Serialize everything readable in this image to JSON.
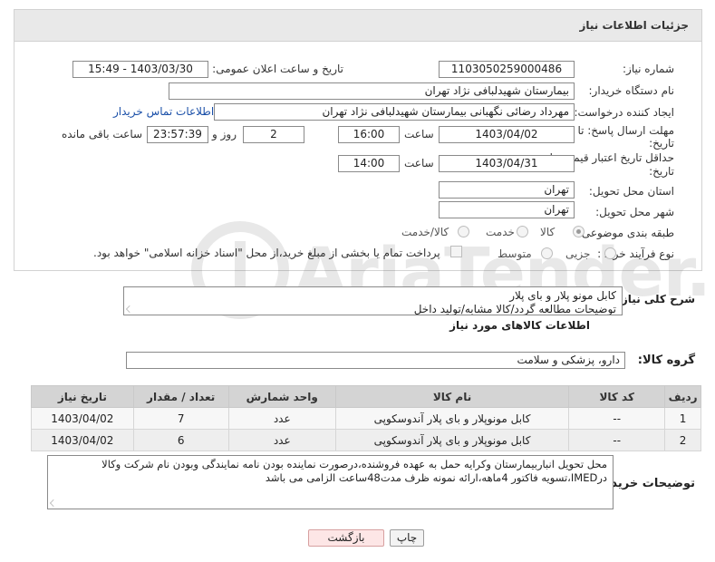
{
  "header": {
    "title": "جزئیات اطلاعات نیاز"
  },
  "fields": {
    "need_number_label": "شماره نیاز:",
    "need_number": "1103050259000486",
    "announce_label": "تاریخ و ساعت اعلان عمومی:",
    "announce_value": "1403/03/30 - 15:49",
    "buyer_org_label": "نام دستگاه خریدار:",
    "buyer_org": "بیمارستان شهیدلبافی نژاد تهران",
    "creator_label": "ایجاد کننده درخواست:",
    "creator": "مهرداد رضائی نگهبانی بیمارستان شهیدلبافی نژاد تهران",
    "contact_link": "اطلاعات تماس خریدار",
    "deadline_label_1": "مهلت ارسال پاسخ: تا",
    "deadline_label_2": "تاریخ:",
    "deadline_date": "1403/04/02",
    "deadline_time_label": "ساعت",
    "deadline_time": "16:00",
    "days_value": "2",
    "days_label": "روز و",
    "remaining_time": "23:57:39",
    "remaining_label": "ساعت باقی مانده",
    "validity_label_1": "حداقل تاریخ اعتبار قیمت: تا",
    "validity_label_2": "تاریخ:",
    "validity_date": "1403/04/31",
    "validity_time_label": "ساعت",
    "validity_time": "14:00",
    "province_label": "استان محل تحویل:",
    "province": "تهران",
    "city_label": "شهر محل تحویل:",
    "city": "تهران",
    "category_label": "طبقه بندی موضوعی:",
    "category_options": [
      "کالا",
      "خدمت",
      "کالا/خدمت"
    ],
    "process_label": "نوع فرآیند خرید :",
    "process_options": [
      "جزیی",
      "متوسط"
    ],
    "payment_note": "پرداخت تمام یا بخشی از مبلغ خرید،از محل \"اسناد خزانه اسلامی\" خواهد بود."
  },
  "summary": {
    "label": "شرح کلی نیاز:",
    "line1": "کابل مونو پلار و بای پلار",
    "line2": "توضیحات مطالعه گردد/کالا مشابه/تولید داخل"
  },
  "goods": {
    "title": "اطلاعات کالاهای مورد نیاز",
    "group_label": "گروه کالا:",
    "group_value": "دارو، پزشکی و سلامت"
  },
  "table": {
    "headers": [
      "ردیف",
      "کد کالا",
      "نام کالا",
      "واحد شمارش",
      "تعداد / مقدار",
      "تاریخ نیاز"
    ],
    "rows": [
      [
        "1",
        "--",
        "کابل مونوپلار و بای پلار آندوسکوپی",
        "عدد",
        "7",
        "1403/04/02"
      ],
      [
        "2",
        "--",
        "کابل مونوپلار و بای پلار آندوسکوپی",
        "عدد",
        "6",
        "1403/04/02"
      ]
    ]
  },
  "buyer_notes": {
    "label": "توضیحات خریدار:",
    "line1": "محل تحویل انباربیمارستان وکرایه حمل به عهده فروشنده،درصورت نماینده بودن نامه نمایندگی وبودن نام شرکت وکالا",
    "line2": "درIMED،تسویه فاکتور 4ماهه،ارائه نمونه ظرف مدت48ساعت الزامی می باشد"
  },
  "buttons": {
    "print": "چاپ",
    "back": "بازگشت"
  },
  "watermark": {
    "text": "AriaTender.net"
  },
  "colors": {
    "link": "#1a4fa8",
    "header_bg": "#e9e9e9",
    "back_button_bg": "#fde6e6"
  }
}
